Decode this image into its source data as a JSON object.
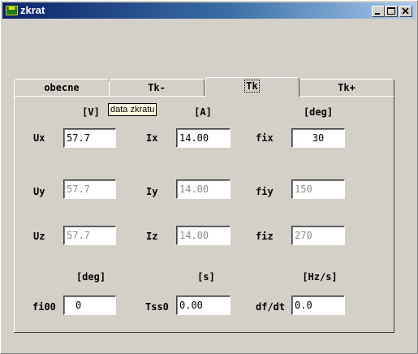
{
  "window": {
    "title": "zkrat",
    "icon": "app-icon",
    "controls": [
      "minimize-icon",
      "maximize-icon",
      "close-icon"
    ]
  },
  "tabs": [
    {
      "label": "obecne",
      "active": false
    },
    {
      "label": "Tk-",
      "active": false
    },
    {
      "label": "Tk",
      "active": true
    },
    {
      "label": "Tk+",
      "active": false
    }
  ],
  "tooltip": "data zkratu",
  "units_top": {
    "voltage": "[V]",
    "current": "[A]",
    "angle": "[deg]"
  },
  "units_bottom": {
    "angle": "[deg]",
    "time": "[s]",
    "rate": "[Hz/s]"
  },
  "rows": {
    "x": {
      "u_label": "Ux",
      "u_value": "57.7",
      "i_label": "Ix",
      "i_value": "14.00",
      "f_label": "fix",
      "f_value": "30"
    },
    "y": {
      "u_label": "Uy",
      "u_value": "57.7",
      "i_label": "Iy",
      "i_value": "14.00",
      "f_label": "fiy",
      "f_value": "150"
    },
    "z": {
      "u_label": "Uz",
      "u_value": "57.7",
      "i_label": "Iz",
      "i_value": "14.00",
      "f_label": "fiz",
      "f_value": "270"
    }
  },
  "bottom": {
    "fi0_label": "fi00",
    "fi0_value": "0",
    "tss_label": "Tss0",
    "tss_value": "0.00",
    "dfdt_label": "df/dt",
    "dfdt_value": "0.0"
  },
  "colors": {
    "face": "#d4d0c8",
    "title_start": "#0a246a",
    "title_end": "#a6caf0",
    "tooltip_bg": "#ffffe1",
    "disabled_text": "#8c8c8c"
  }
}
